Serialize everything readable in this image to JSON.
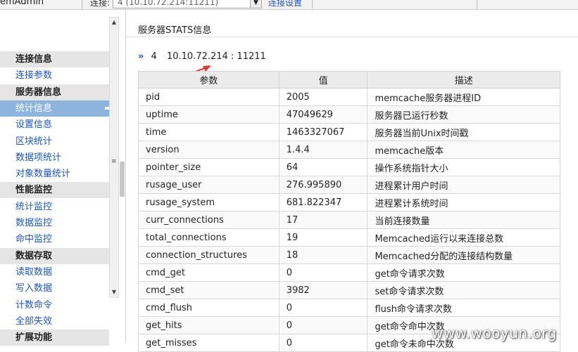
{
  "topbar": {
    "app_title": "emAdmin",
    "connection_label": "连接:",
    "connection_value": "4 (10.10.72.214:11211)",
    "connection_settings_link": "连接设置"
  },
  "sidebar": {
    "items": [
      {
        "label": "连接信息",
        "kind": "head"
      },
      {
        "label": "连接参数",
        "kind": "link"
      },
      {
        "label": "服务器信息",
        "kind": "head"
      },
      {
        "label": "统计信息",
        "kind": "active"
      },
      {
        "label": "设置信息",
        "kind": "link"
      },
      {
        "label": "区块统计",
        "kind": "link"
      },
      {
        "label": "数据项统计",
        "kind": "link"
      },
      {
        "label": "对象数量统计",
        "kind": "link"
      },
      {
        "label": "性能监控",
        "kind": "head"
      },
      {
        "label": "统计监控",
        "kind": "link"
      },
      {
        "label": "数据监控",
        "kind": "link"
      },
      {
        "label": "命中监控",
        "kind": "link"
      },
      {
        "label": "数据存取",
        "kind": "head"
      },
      {
        "label": "读取数据",
        "kind": "link"
      },
      {
        "label": "写入数据",
        "kind": "link"
      },
      {
        "label": "计数命令",
        "kind": "link"
      },
      {
        "label": "全部失效",
        "kind": "link"
      },
      {
        "label": "扩展功能",
        "kind": "head"
      }
    ]
  },
  "main": {
    "page_title": "服务器STATS信息",
    "server": {
      "chevron": "»",
      "id": "4",
      "address": "10.10.72.214 : 11211"
    },
    "table": {
      "headers": [
        "参数",
        "值",
        "描述"
      ],
      "rows": [
        [
          "pid",
          "2005",
          "memcache服务器进程ID"
        ],
        [
          "uptime",
          "47049629",
          "服务器已运行秒数"
        ],
        [
          "time",
          "1463327067",
          "服务器当前Unix时间戳"
        ],
        [
          "version",
          "1.4.4",
          "memcache版本"
        ],
        [
          "pointer_size",
          "64",
          "操作系统指针大小"
        ],
        [
          "rusage_user",
          "276.995890",
          "进程累计用户时间"
        ],
        [
          "rusage_system",
          "681.822347",
          "进程累计系统时间"
        ],
        [
          "curr_connections",
          "17",
          "当前连接数量"
        ],
        [
          "total_connections",
          "19",
          "Memcached运行以来连接总数"
        ],
        [
          "connection_structures",
          "18",
          "Memcached分配的连接结构数量"
        ],
        [
          "cmd_get",
          "0",
          "get命令请求次数"
        ],
        [
          "cmd_set",
          "3982",
          "set命令请求次数"
        ],
        [
          "cmd_flush",
          "0",
          "flush命令请求次数"
        ],
        [
          "get_hits",
          "0",
          "get命令命中次数"
        ],
        [
          "get_misses",
          "0",
          "get命令未命中次数"
        ]
      ]
    }
  },
  "watermark": "www.wooyun.org",
  "colors": {
    "link": "#1d57c2",
    "active_bg": "#8cb4dc",
    "annotation_arrow": "#e23b2e"
  }
}
